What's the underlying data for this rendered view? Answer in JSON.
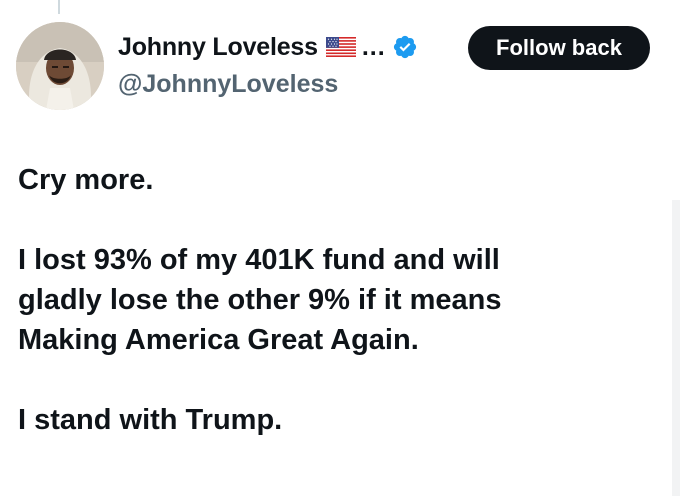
{
  "author": {
    "display_name": "Johnny Loveless",
    "flag_icon": "us-flag-icon",
    "ellipsis": "...",
    "verified_icon": "verified-badge-icon",
    "verified_color": "#1d9bf0",
    "handle": "@JohnnyLoveless"
  },
  "actions": {
    "follow_label": "Follow back"
  },
  "tweet": {
    "paragraphs": [
      "Cry more.",
      "I lost 93% of my 401K fund and will gladly lose the other 9% if it means Making America Great Again.",
      "I stand with Trump."
    ]
  }
}
